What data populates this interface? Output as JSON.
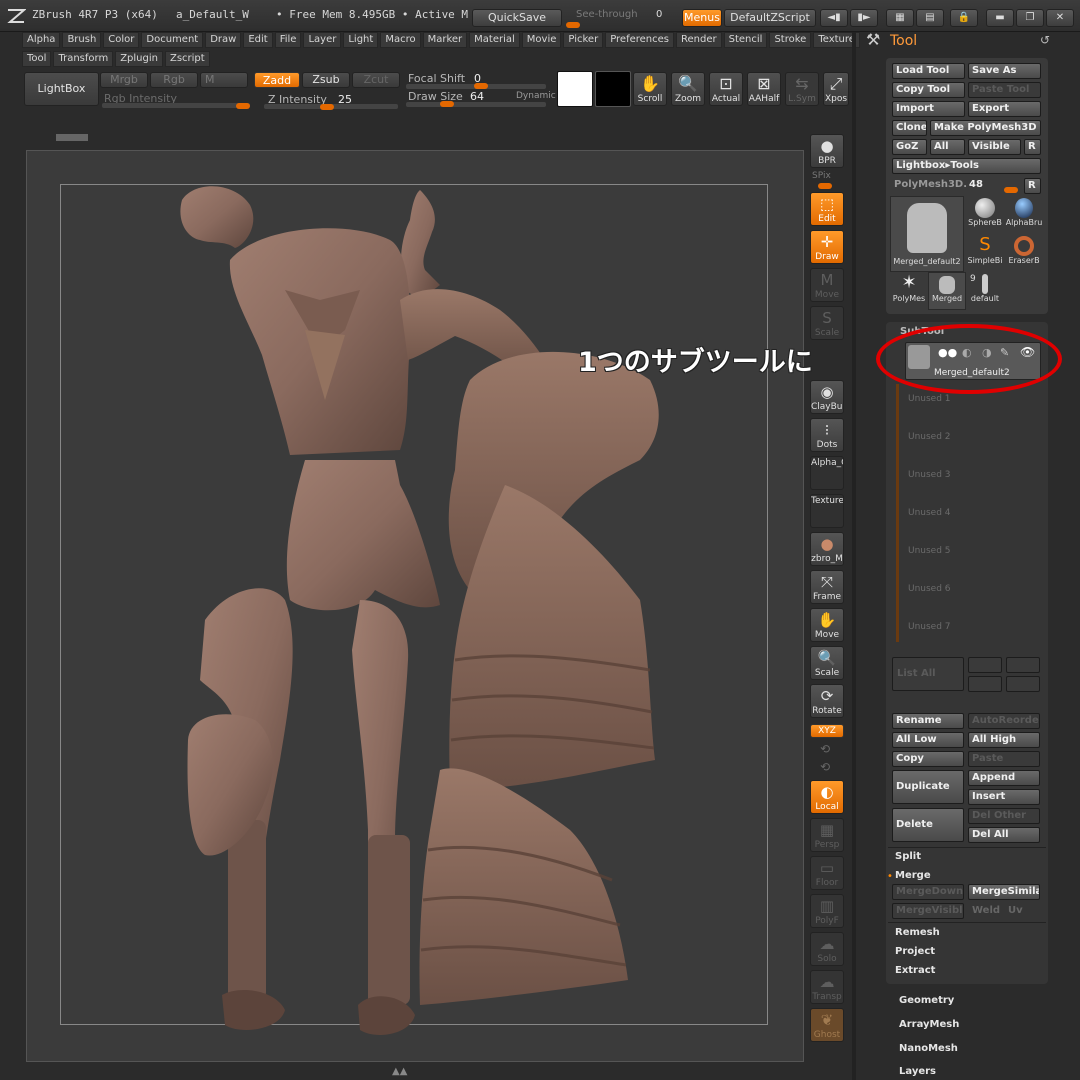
{
  "titlebar": {
    "app": "ZBrush 4R7 P3 (x64)",
    "doc": "a_Default_W",
    "mem": "• Free Mem 8.495GB • Active M",
    "quicksave": "QuickSave",
    "seethrough": "See-through",
    "seethrough_val": "0",
    "menus": "Menus",
    "script": "DefaultZScript"
  },
  "menus_row1": [
    "Alpha",
    "Brush",
    "Color",
    "Document",
    "Draw",
    "Edit",
    "File",
    "Layer",
    "Light",
    "Macro",
    "Marker",
    "Material",
    "Movie",
    "Picker",
    "Preferences",
    "Render",
    "Stencil",
    "Stroke",
    "Texture"
  ],
  "menus_row2": [
    "Tool",
    "Transform",
    "Zplugin",
    "Zscript"
  ],
  "shelf": {
    "lightbox": "LightBox",
    "mrgb": "Mrgb",
    "rgb": "Rgb",
    "m": "M",
    "zadd": "Zadd",
    "zsub": "Zsub",
    "zcut": "Zcut",
    "rgb_intensity": "Rgb Intensity",
    "z_intensity_label": "Z Intensity",
    "z_intensity": "25",
    "focal_label": "Focal Shift",
    "focal": "0",
    "draw_label": "Draw Size",
    "draw_size": "64",
    "dynamic": "Dynamic",
    "scroll": "Scroll",
    "zoom": "Zoom",
    "actual": "Actual",
    "aahalf": "AAHalf",
    "lsym": "L.Sym",
    "xpos": "Xpos"
  },
  "right_shelf": {
    "bpr": "BPR",
    "spix": "SPix",
    "edit": "Edit",
    "draw": "Draw",
    "move_dim": "Move",
    "scale_dim": "Scale",
    "claybuild": "ClayBuil",
    "dots": "Dots",
    "alpha": "Alpha_C",
    "texture": "Texture",
    "material": "zbro_M",
    "frame": "Frame",
    "move": "Move",
    "scale": "Scale",
    "rotate": "Rotate",
    "xyz": "XYZ",
    "local": "Local",
    "persp": "Persp",
    "floor": "Floor",
    "polyf": "PolyF",
    "solo": "Solo",
    "transp": "Transp",
    "ghost": "Ghost"
  },
  "annotation": "1つのサブツールに",
  "panel": {
    "title": "Tool",
    "load_tool": "Load Tool",
    "save_as": "Save As",
    "copy_tool": "Copy Tool",
    "paste_tool": "Paste Tool",
    "import": "Import",
    "export": "Export",
    "clone": "Clone",
    "make_polymesh": "Make PolyMesh3D",
    "goz": "GoZ",
    "all": "All",
    "visible": "Visible",
    "r": "R",
    "lightbox_tools": "Lightbox▸Tools",
    "polymesh_label": "PolyMesh3D.",
    "polymesh_val": "48",
    "thumbs": [
      "Merged_default2",
      "SphereB",
      "AlphaBru",
      "SimpleBi",
      "EraserB",
      "PolyMes",
      "Merged",
      "default"
    ],
    "thumb_count": "9",
    "subtool": "SubTool",
    "subtool_item": "Merged_default2",
    "unused": [
      "Unused 1",
      "Unused 2",
      "Unused 3",
      "Unused 4",
      "Unused 5",
      "Unused 6",
      "Unused 7"
    ],
    "list_all": "List All",
    "rename": "Rename",
    "autoreorder": "AutoReorder",
    "all_low": "All Low",
    "all_high": "All High",
    "copy": "Copy",
    "paste": "Paste",
    "duplicate": "Duplicate",
    "append": "Append",
    "insert": "Insert",
    "delete": "Delete",
    "del_other": "Del Other",
    "del_all": "Del All",
    "split": "Split",
    "merge": "Merge",
    "mergedown": "MergeDown",
    "mergesimilar": "MergeSimilar",
    "mergevisible": "MergeVisible",
    "weld": "Weld",
    "uv": "Uv",
    "remesh": "Remesh",
    "project": "Project",
    "extract": "Extract",
    "geometry": "Geometry",
    "arraymesh": "ArrayMesh",
    "nanomesh": "NanoMesh",
    "layers": "Layers"
  },
  "colors": {
    "accent": "#e26a00",
    "annotation_ring": "#e00000",
    "clay": "#8a6a5e"
  }
}
